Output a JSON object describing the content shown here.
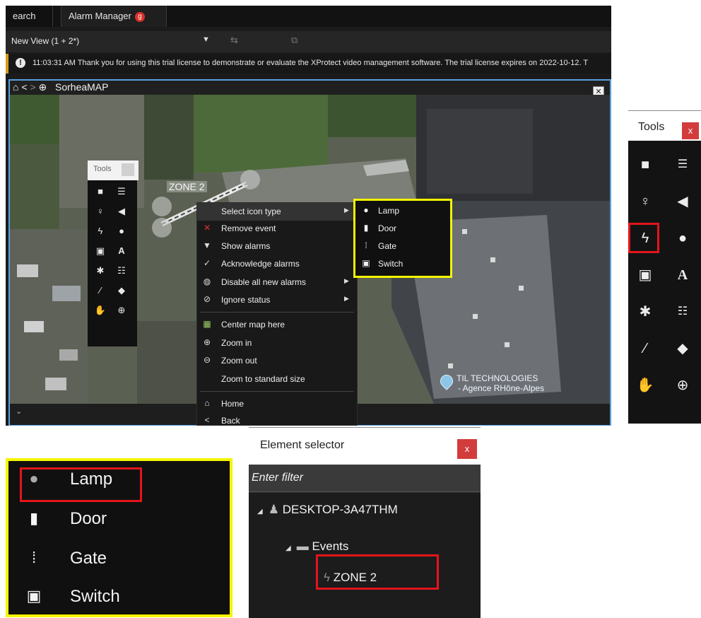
{
  "tabs": [
    {
      "label": "earch"
    },
    {
      "label": "Alarm Manager",
      "badge": "g"
    }
  ],
  "view": {
    "name": "New View (1 + 2*)",
    "dropdown_icon": "triangle-down-icon"
  },
  "notice": {
    "text": "11:03:31 AM   Thank you for using this trial license to demonstrate or evaluate the XProtect video management software. The trial license expires on 2022-10-12. T"
  },
  "map": {
    "title": "SorheaMAP",
    "zone_label": "ZONE 2",
    "location_line1": "TIL TECHNOLOGIES",
    "location_line2": "- Agence RHône-Alpes"
  },
  "mini_tools": {
    "title": "Tools"
  },
  "context_menu": {
    "items": [
      {
        "label": "Select icon type",
        "icon": "none",
        "submenu": true
      },
      {
        "label": "Remove event",
        "icon": "x-icon"
      },
      {
        "label": "Show alarms",
        "icon": "funnel-icon"
      },
      {
        "label": "Acknowledge alarms",
        "icon": "check-icon"
      },
      {
        "label": "Disable all new alarms",
        "icon": "alarm-disable-icon",
        "submenu": true
      },
      {
        "label": "Ignore status",
        "icon": "ban-icon",
        "submenu": true
      },
      {
        "label": "Center map here",
        "icon": "center-map-icon"
      },
      {
        "label": "Zoom in",
        "icon": "zoom-in-icon"
      },
      {
        "label": "Zoom out",
        "icon": "zoom-out-icon"
      },
      {
        "label": "Zoom to standard size",
        "icon": "none"
      },
      {
        "label": "Home",
        "icon": "home-icon"
      },
      {
        "label": "Back",
        "icon": "back-icon"
      }
    ]
  },
  "icon_types": {
    "items": [
      {
        "label": "Lamp",
        "icon": "lamp-icon"
      },
      {
        "label": "Door",
        "icon": "door-icon"
      },
      {
        "label": "Gate",
        "icon": "gate-icon"
      },
      {
        "label": "Switch",
        "icon": "switch-icon"
      }
    ]
  },
  "tools_panel": {
    "title": "Tools",
    "close_label": "x"
  },
  "element_selector": {
    "title": "Element selector",
    "close_label": "x",
    "filter_placeholder": "Enter filter",
    "tree": {
      "root": "DESKTOP-3A47THM",
      "folder": "Events",
      "leaf": "ZONE 2"
    }
  },
  "colors": {
    "highlight_yellow": "#f5f500",
    "highlight_red": "#e3151a",
    "close_red": "#d23c3c",
    "map_border_blue": "#5a9ee0",
    "notice_amber": "#d89b1d"
  }
}
